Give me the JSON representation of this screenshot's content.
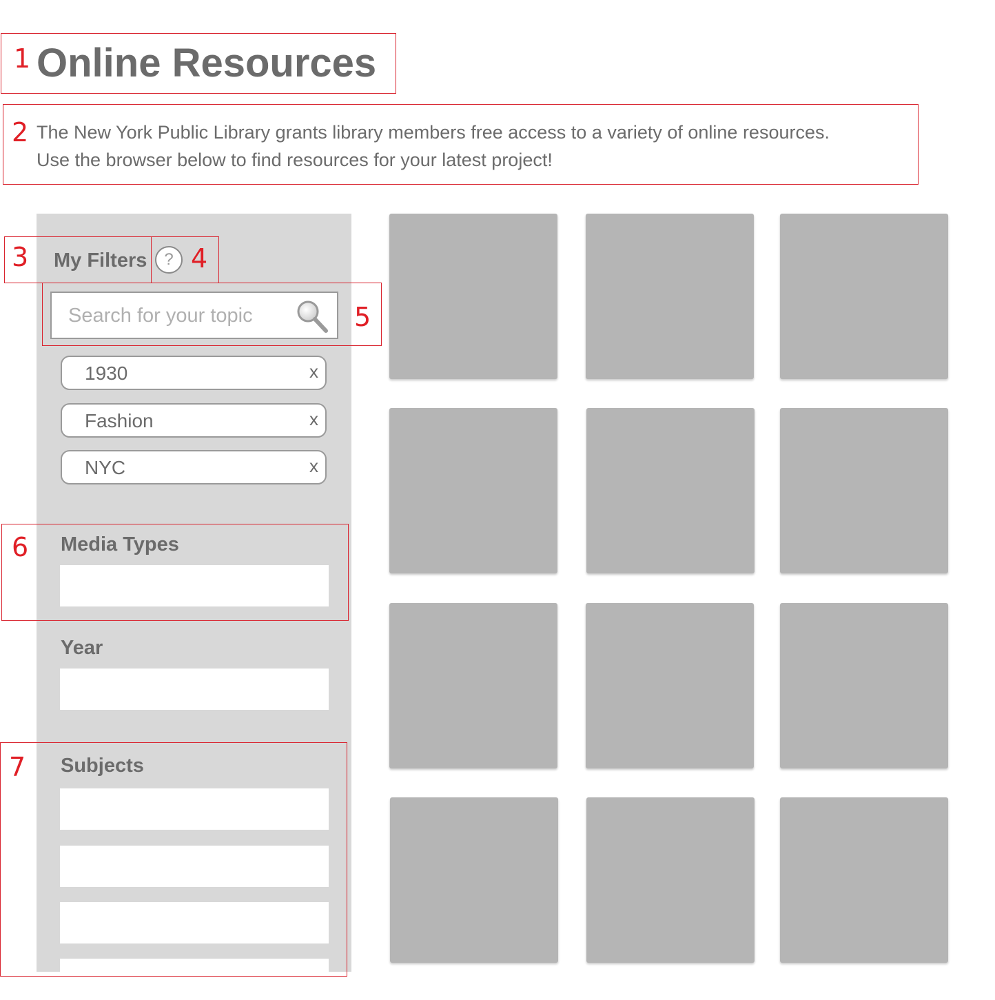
{
  "page": {
    "title": "Online Resources",
    "intro_lines": [
      "The New York Public Library grants library members free access to a variety of online resources.",
      "Use the browser below to find resources for your latest project!"
    ]
  },
  "filters": {
    "heading": "My Filters",
    "help_label": "?",
    "search": {
      "placeholder": "Search for your topic",
      "value": ""
    },
    "active": [
      {
        "label": "1930",
        "remove": "x"
      },
      {
        "label": "Fashion",
        "remove": "x"
      },
      {
        "label": "NYC",
        "remove": "x"
      }
    ]
  },
  "sections": {
    "media_types": "Media Types",
    "year": "Year",
    "subjects": "Subjects"
  },
  "annotations": [
    "1",
    "2",
    "3",
    "4",
    "5",
    "6",
    "7"
  ],
  "colors": {
    "annotation_red": "#e01f26",
    "text_gray": "#6b6b6b",
    "sidebar_bg": "#d8d8d8",
    "tile_gray": "#b5b5b5"
  }
}
